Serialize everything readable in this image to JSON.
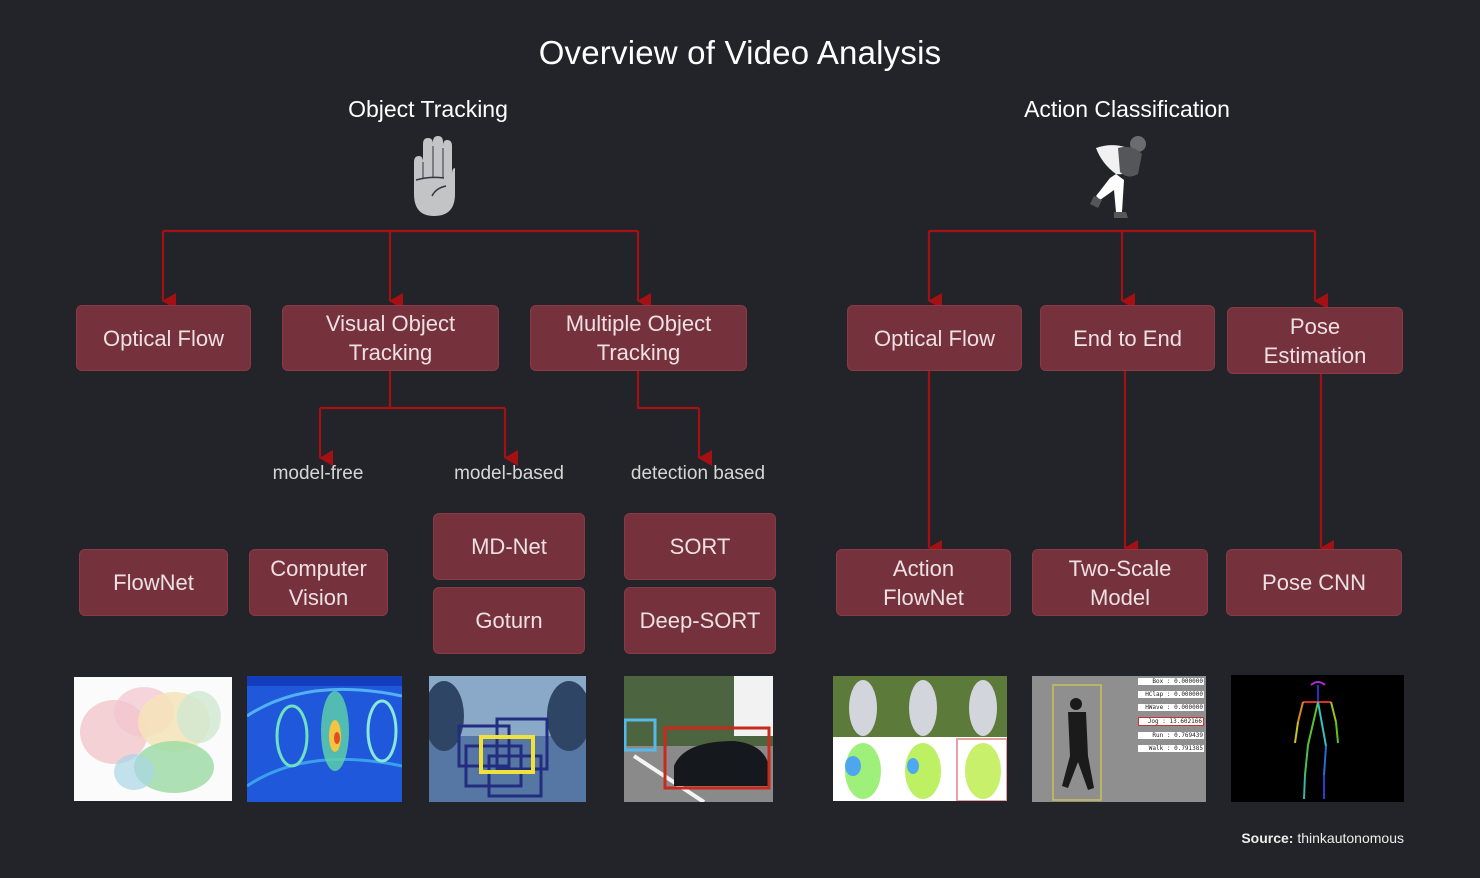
{
  "title": "Overview of Video Analysis",
  "sections": {
    "object_tracking": {
      "title": "Object Tracking",
      "icon": "raised-hand-icon",
      "categories": [
        "Optical Flow",
        "Visual Object\nTracking",
        "Multiple Object\nTracking"
      ],
      "sub_labels": [
        "model-free",
        "model-based",
        "detection based"
      ],
      "methods": [
        "FlowNet",
        "Computer\nVision",
        "MD-Net",
        "Goturn",
        "SORT",
        "Deep-SORT"
      ],
      "thumbnails": [
        "optical-flow-image",
        "heatmap-image",
        "bounding-box-image",
        "car-tracking-image"
      ]
    },
    "action_classification": {
      "title": "Action Classification",
      "icon": "running-thief-icon",
      "categories": [
        "Optical Flow",
        "End to End",
        "Pose\nEstimation"
      ],
      "methods": [
        "Action\nFlowNet",
        "Two-Scale\nModel",
        "Pose CNN"
      ],
      "thumbnails": [
        "pitcher-flow-image",
        "walking-person-image",
        "pose-skeleton-image"
      ],
      "action_scores": [
        {
          "label": "Box",
          "value": "0.000000"
        },
        {
          "label": "HClap",
          "value": "0.000000"
        },
        {
          "label": "HWave",
          "value": "0.000000"
        },
        {
          "label": "Jog",
          "value": "13.602166"
        },
        {
          "label": "Run",
          "value": "0.769439"
        },
        {
          "label": "Walk",
          "value": "0.791385"
        }
      ],
      "pose_keypoints": [
        "0",
        "1",
        "2",
        "3",
        "4",
        "5",
        "6",
        "7",
        "8",
        "9",
        "10",
        "11",
        "12",
        "13",
        "14",
        "15",
        "16",
        "17"
      ]
    }
  },
  "colors": {
    "background": "#222429",
    "node_fill": "#76323c",
    "connector": "#a51014",
    "text": "#ffffff"
  },
  "source": {
    "label": "Source:",
    "value": "thinkautonomous"
  }
}
